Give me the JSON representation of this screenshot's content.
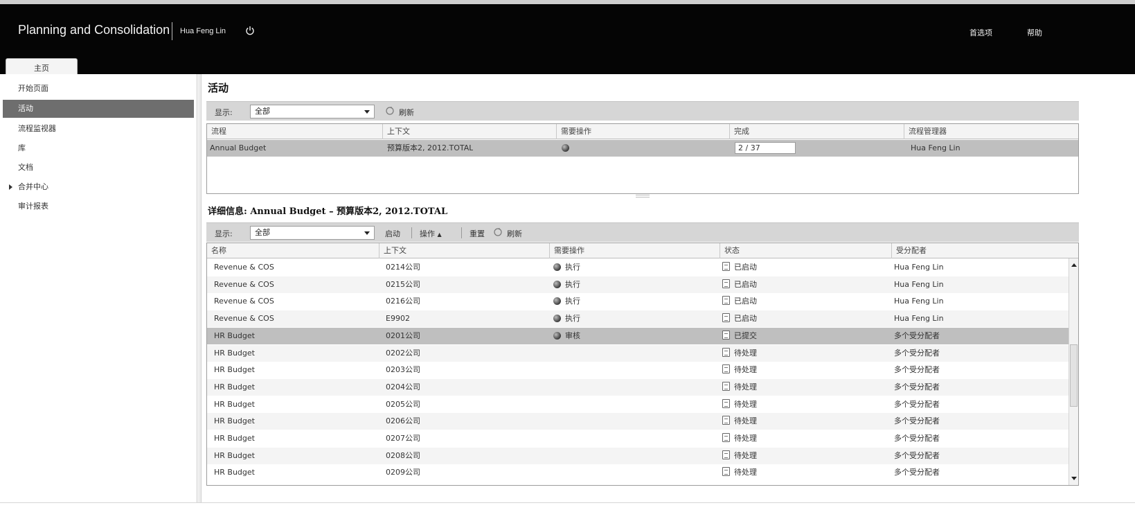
{
  "header": {
    "app_title": "Planning and Consolidation",
    "user_name": "Hua Feng Lin",
    "options_label": "首选项",
    "help_label": "帮助"
  },
  "tabs": [
    {
      "label": "主页"
    }
  ],
  "sidebar": {
    "items": [
      {
        "label": "开始页面"
      },
      {
        "label": "活动"
      },
      {
        "label": "流程监视器"
      },
      {
        "label": "库"
      },
      {
        "label": "文档"
      },
      {
        "label": "合并中心"
      },
      {
        "label": "审计报表"
      }
    ]
  },
  "activity": {
    "title": "活动",
    "show_label": "显示:",
    "show_value": "全部",
    "refresh_label": "刷新",
    "columns": [
      "流程",
      "上下文",
      "需要操作",
      "完成",
      "流程管理器"
    ],
    "rows": [
      {
        "process": "Annual Budget",
        "context": "预算版本2, 2012.TOTAL",
        "progress": "2 / 37",
        "manager": "Hua Feng Lin"
      }
    ]
  },
  "details": {
    "title": "详细信息: Annual Budget – 预算版本2, 2012.TOTAL",
    "show_label": "显示:",
    "show_value": "全部",
    "launch_label": "启动",
    "actions_label": "操作",
    "reset_label": "重置",
    "refresh_label": "刷新",
    "columns": [
      "名称",
      "上下文",
      "需要操作",
      "状态",
      "受分配者"
    ],
    "rows": [
      {
        "name": "Revenue & COS",
        "context": "0214公司",
        "action": "执行",
        "status": "已启动",
        "assignee": "Hua Feng Lin"
      },
      {
        "name": "Revenue & COS",
        "context": "0215公司",
        "action": "执行",
        "status": "已启动",
        "assignee": "Hua Feng Lin"
      },
      {
        "name": "Revenue & COS",
        "context": "0216公司",
        "action": "执行",
        "status": "已启动",
        "assignee": "Hua Feng Lin"
      },
      {
        "name": "Revenue & COS",
        "context": "E9902",
        "action": "执行",
        "status": "已启动",
        "assignee": "Hua Feng Lin"
      },
      {
        "name": "HR Budget",
        "context": "0201公司",
        "action": "审核",
        "status": "已提交",
        "assignee": "多个受分配者"
      },
      {
        "name": "HR Budget",
        "context": "0202公司",
        "action": "",
        "status": "待处理",
        "assignee": "多个受分配者"
      },
      {
        "name": "HR Budget",
        "context": "0203公司",
        "action": "",
        "status": "待处理",
        "assignee": "多个受分配者"
      },
      {
        "name": "HR Budget",
        "context": "0204公司",
        "action": "",
        "status": "待处理",
        "assignee": "多个受分配者"
      },
      {
        "name": "HR Budget",
        "context": "0205公司",
        "action": "",
        "status": "待处理",
        "assignee": "多个受分配者"
      },
      {
        "name": "HR Budget",
        "context": "0206公司",
        "action": "",
        "status": "待处理",
        "assignee": "多个受分配者"
      },
      {
        "name": "HR Budget",
        "context": "0207公司",
        "action": "",
        "status": "待处理",
        "assignee": "多个受分配者"
      },
      {
        "name": "HR Budget",
        "context": "0208公司",
        "action": "",
        "status": "待处理",
        "assignee": "多个受分配者"
      },
      {
        "name": "HR Budget",
        "context": "0209公司",
        "action": "",
        "status": "待处理",
        "assignee": "多个受分配者"
      }
    ]
  }
}
